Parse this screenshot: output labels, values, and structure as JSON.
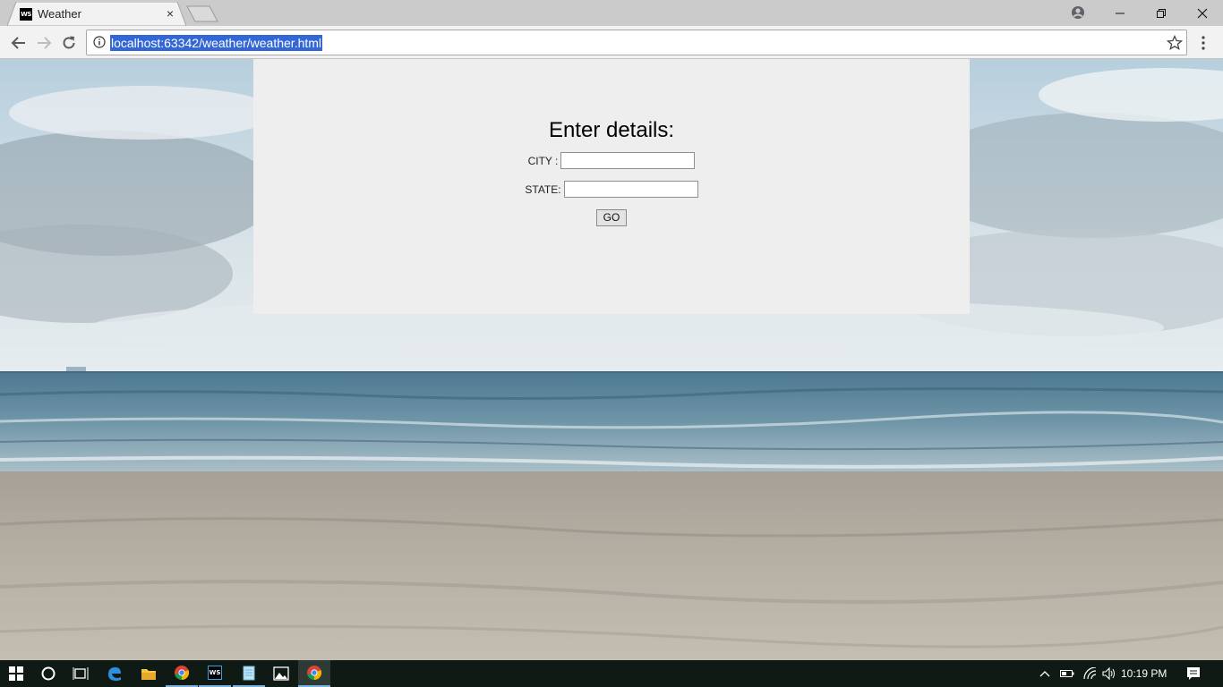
{
  "browser": {
    "tab": {
      "favicon_text": "WS",
      "title": "Weather",
      "close_glyph": "×"
    },
    "address_bar": {
      "url": "localhost:63342/weather/weather.html"
    }
  },
  "page": {
    "heading": "Enter details:",
    "city": {
      "label": "CITY :",
      "value": ""
    },
    "state": {
      "label": "STATE:",
      "value": ""
    },
    "submit_label": "GO"
  },
  "taskbar": {
    "apps": [
      "start-icon",
      "cortana-icon",
      "task-view-icon",
      "edge-icon",
      "file-explorer-icon",
      "chrome-icon",
      "webstorm-icon",
      "notepad-icon",
      "photos-icon",
      "chrome-icon"
    ],
    "ws_icon_text": "WS",
    "clock": "10:19 PM"
  },
  "colors": {
    "url_selection": "#3367d6",
    "panel_bg": "#eeeeee",
    "taskbar_bg": "#101a14",
    "taskbar_accent": "#7ab2de"
  }
}
